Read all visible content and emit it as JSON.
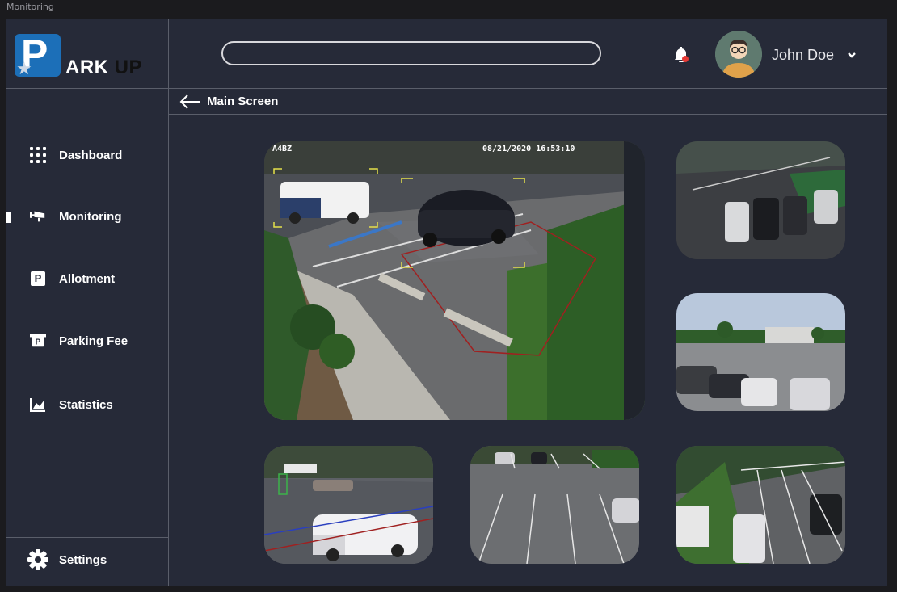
{
  "window": {
    "title": "Monitoring"
  },
  "brand": {
    "logo_letter": "P",
    "name_part1": "ARK",
    "name_part2": "UP"
  },
  "sidebar": {
    "items": [
      {
        "label": "Dashboard",
        "icon": "grid-icon"
      },
      {
        "label": "Monitoring",
        "icon": "cctv-camera-icon",
        "active": true
      },
      {
        "label": "Allotment",
        "icon": "parking-icon"
      },
      {
        "label": "Parking Fee",
        "icon": "parking-ticket-icon"
      },
      {
        "label": "Statistics",
        "icon": "chart-icon"
      }
    ],
    "settings_label": "Settings"
  },
  "topbar": {
    "search_value": "",
    "user_name": "John Doe",
    "notification_indicator_color": "#e53935"
  },
  "breadcrumb": {
    "label": "Main Screen"
  },
  "main_feed": {
    "camera_id": "A4BZ",
    "timestamp": "08/21/2020 16:53:10"
  },
  "colors": {
    "background": "#262a38",
    "divider": "#5a5e6a",
    "brand_blue": "#1c6fb8"
  }
}
